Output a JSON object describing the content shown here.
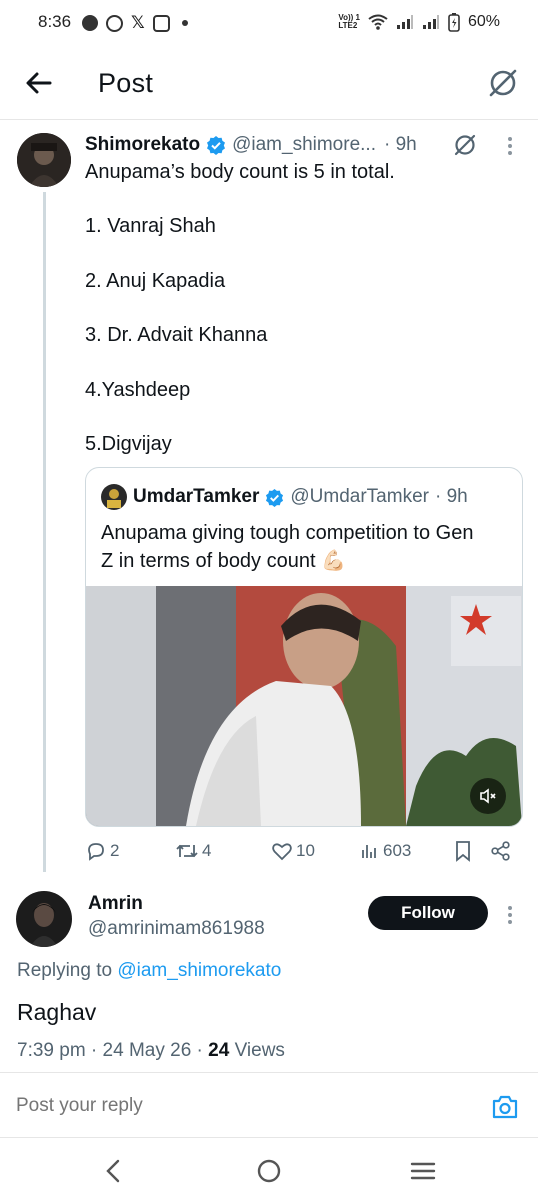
{
  "status_bar": {
    "time": "8:36",
    "battery": "60%",
    "network_top": "Vo)) 1",
    "network_bottom": "LTE2"
  },
  "header": {
    "title": "Post"
  },
  "tweet": {
    "author_name": "Shimorekato",
    "author_handle": "@iam_shimore...",
    "time": "· 9h",
    "lines": [
      "Anupama’s body count is 5 in total.",
      "1. Vanraj Shah",
      "2. Anuj Kapadia",
      "3. Dr. Advait Khanna",
      "4.Yashdeep",
      "5.Digvijay"
    ],
    "quote": {
      "author_name": "UmdarTamker",
      "author_handle": "@UmdarTamker",
      "time": "· 9h",
      "text_line1": "Anupama giving tough competition to Gen",
      "text_line2": "Z in terms of body count",
      "emoji": "💪🏻"
    },
    "stats": {
      "replies": "2",
      "reposts": "4",
      "likes": "10",
      "views": "603"
    }
  },
  "reply": {
    "author_name": "Amrin",
    "author_handle": "@amrinimam861988",
    "follow_label": "Follow",
    "replying_prefix": "Replying to",
    "replying_to": "@iam_shimorekato",
    "text": "Raghav",
    "meta": "7:39 pm · 24 May 26 ·",
    "views_count": "24",
    "views_label": "Views"
  },
  "composer": {
    "placeholder": "Post your reply"
  },
  "colors": {
    "link": "#1d9bf0",
    "verified": "#1d9bf0",
    "follow_bg": "#0f1419",
    "muted": "#536471"
  }
}
